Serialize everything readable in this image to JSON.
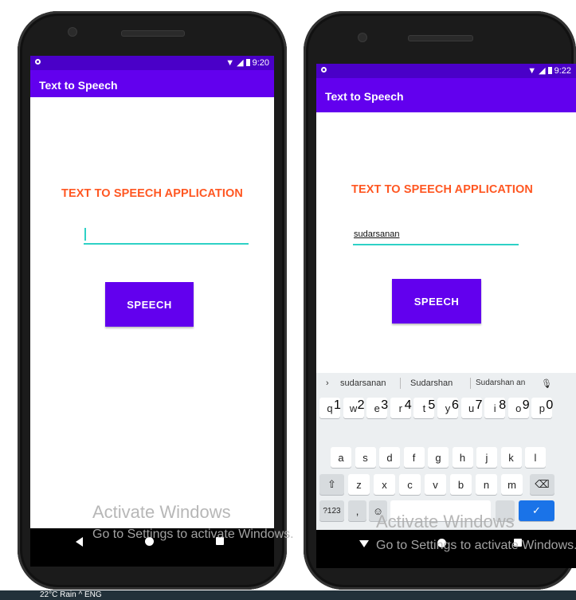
{
  "left_phone": {
    "status": {
      "time": "9:20"
    },
    "app": {
      "title": "Text to Speech",
      "heading": "TEXT TO SPEECH APPLICATION",
      "input_value": "",
      "button_label": "SPEECH"
    }
  },
  "right_phone": {
    "status": {
      "time": "9:22"
    },
    "app": {
      "title": "Text to Speech",
      "heading": "TEXT TO SPEECH APPLICATION",
      "input_value": "sudarsanan",
      "button_label": "SPEECH"
    },
    "keyboard": {
      "suggestions": [
        "sudarsanan",
        "Sudarshan",
        "Sudarshan an"
      ],
      "row1": [
        {
          "k": "q",
          "s": "1"
        },
        {
          "k": "w",
          "s": "2"
        },
        {
          "k": "e",
          "s": "3"
        },
        {
          "k": "r",
          "s": "4"
        },
        {
          "k": "t",
          "s": "5"
        },
        {
          "k": "y",
          "s": "6"
        },
        {
          "k": "u",
          "s": "7"
        },
        {
          "k": "i",
          "s": "8"
        },
        {
          "k": "o",
          "s": "9"
        },
        {
          "k": "p",
          "s": "0"
        }
      ],
      "row2": [
        "a",
        "s",
        "d",
        "f",
        "g",
        "h",
        "j",
        "k",
        "l"
      ],
      "row3": [
        "z",
        "x",
        "c",
        "v",
        "b",
        "n",
        "m"
      ],
      "symbols_label": "?123",
      "comma_label": ","
    }
  },
  "watermark": {
    "line1": "Activate Windows",
    "line2": "Go to Settings to activate Windows."
  },
  "taskbar": {
    "text": "22°C  Rain  ^  ENG"
  },
  "colors": {
    "status_bar": "#4a00c8",
    "app_bar": "#6200ee",
    "heading": "#ff5722",
    "input_underline": "#2ed1c6",
    "button": "#6200ee"
  }
}
